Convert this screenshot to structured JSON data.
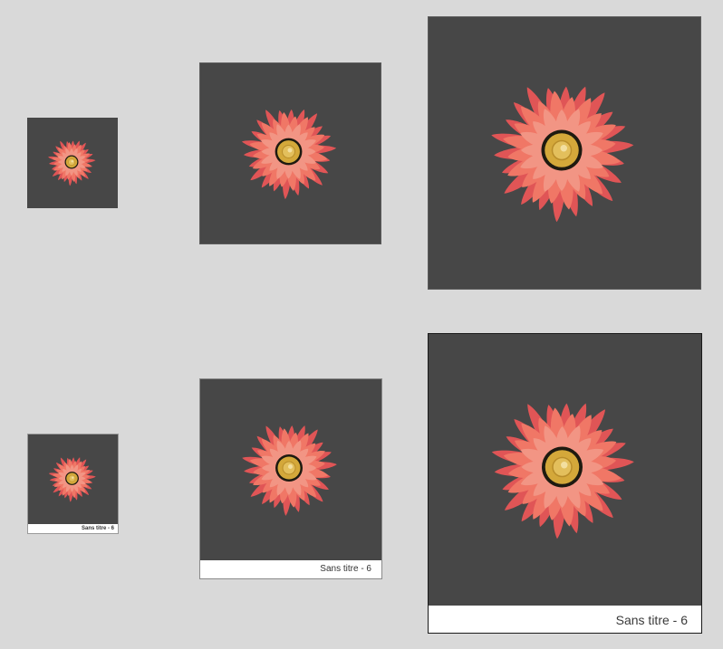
{
  "thumbnail_title": "Sans titre - 6",
  "colors": {
    "canvas_background": "#474747",
    "page_background": "#d9d9d9",
    "petal_dark": "#e05556",
    "petal_mid": "#f07766",
    "petal_light": "#f29584",
    "flower_center": "#d4a83a",
    "flower_center_ring": "#1e1a10"
  },
  "thumbnails": [
    {
      "id": "small-plain",
      "has_caption": false
    },
    {
      "id": "medium-plain",
      "has_caption": false
    },
    {
      "id": "large-plain",
      "has_caption": false
    },
    {
      "id": "small-captioned",
      "has_caption": true
    },
    {
      "id": "medium-captioned",
      "has_caption": true
    },
    {
      "id": "large-captioned",
      "has_caption": true
    }
  ]
}
